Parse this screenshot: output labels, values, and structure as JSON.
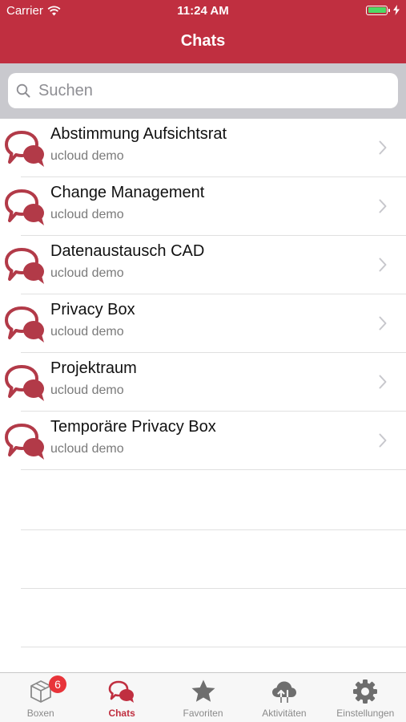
{
  "status_bar": {
    "carrier": "Carrier",
    "time": "11:24 AM",
    "battery_level": 1.0
  },
  "nav": {
    "title": "Chats"
  },
  "search": {
    "placeholder": "Suchen"
  },
  "chats": [
    {
      "title": "Abstimmung Aufsichtsrat",
      "subtitle": "ucloud demo"
    },
    {
      "title": "Change Management",
      "subtitle": "ucloud demo"
    },
    {
      "title": "Datenaustausch CAD",
      "subtitle": "ucloud demo"
    },
    {
      "title": "Privacy Box",
      "subtitle": "ucloud demo"
    },
    {
      "title": "Projektraum",
      "subtitle": "ucloud demo"
    },
    {
      "title": "Temporäre Privacy Box",
      "subtitle": "ucloud demo"
    }
  ],
  "tabbar": {
    "tabs": [
      {
        "label": "Boxen",
        "icon": "box-icon",
        "badge": "6"
      },
      {
        "label": "Chats",
        "icon": "chat-icon",
        "active": true
      },
      {
        "label": "Favoriten",
        "icon": "star-icon"
      },
      {
        "label": "Aktivitäten",
        "icon": "cloud-transfer-icon"
      },
      {
        "label": "Einstellungen",
        "icon": "gear-icon"
      }
    ]
  },
  "colors": {
    "brand": "#c02f40",
    "icon": "#b23a48",
    "badge": "#e8343a",
    "battery": "#4cd964"
  }
}
